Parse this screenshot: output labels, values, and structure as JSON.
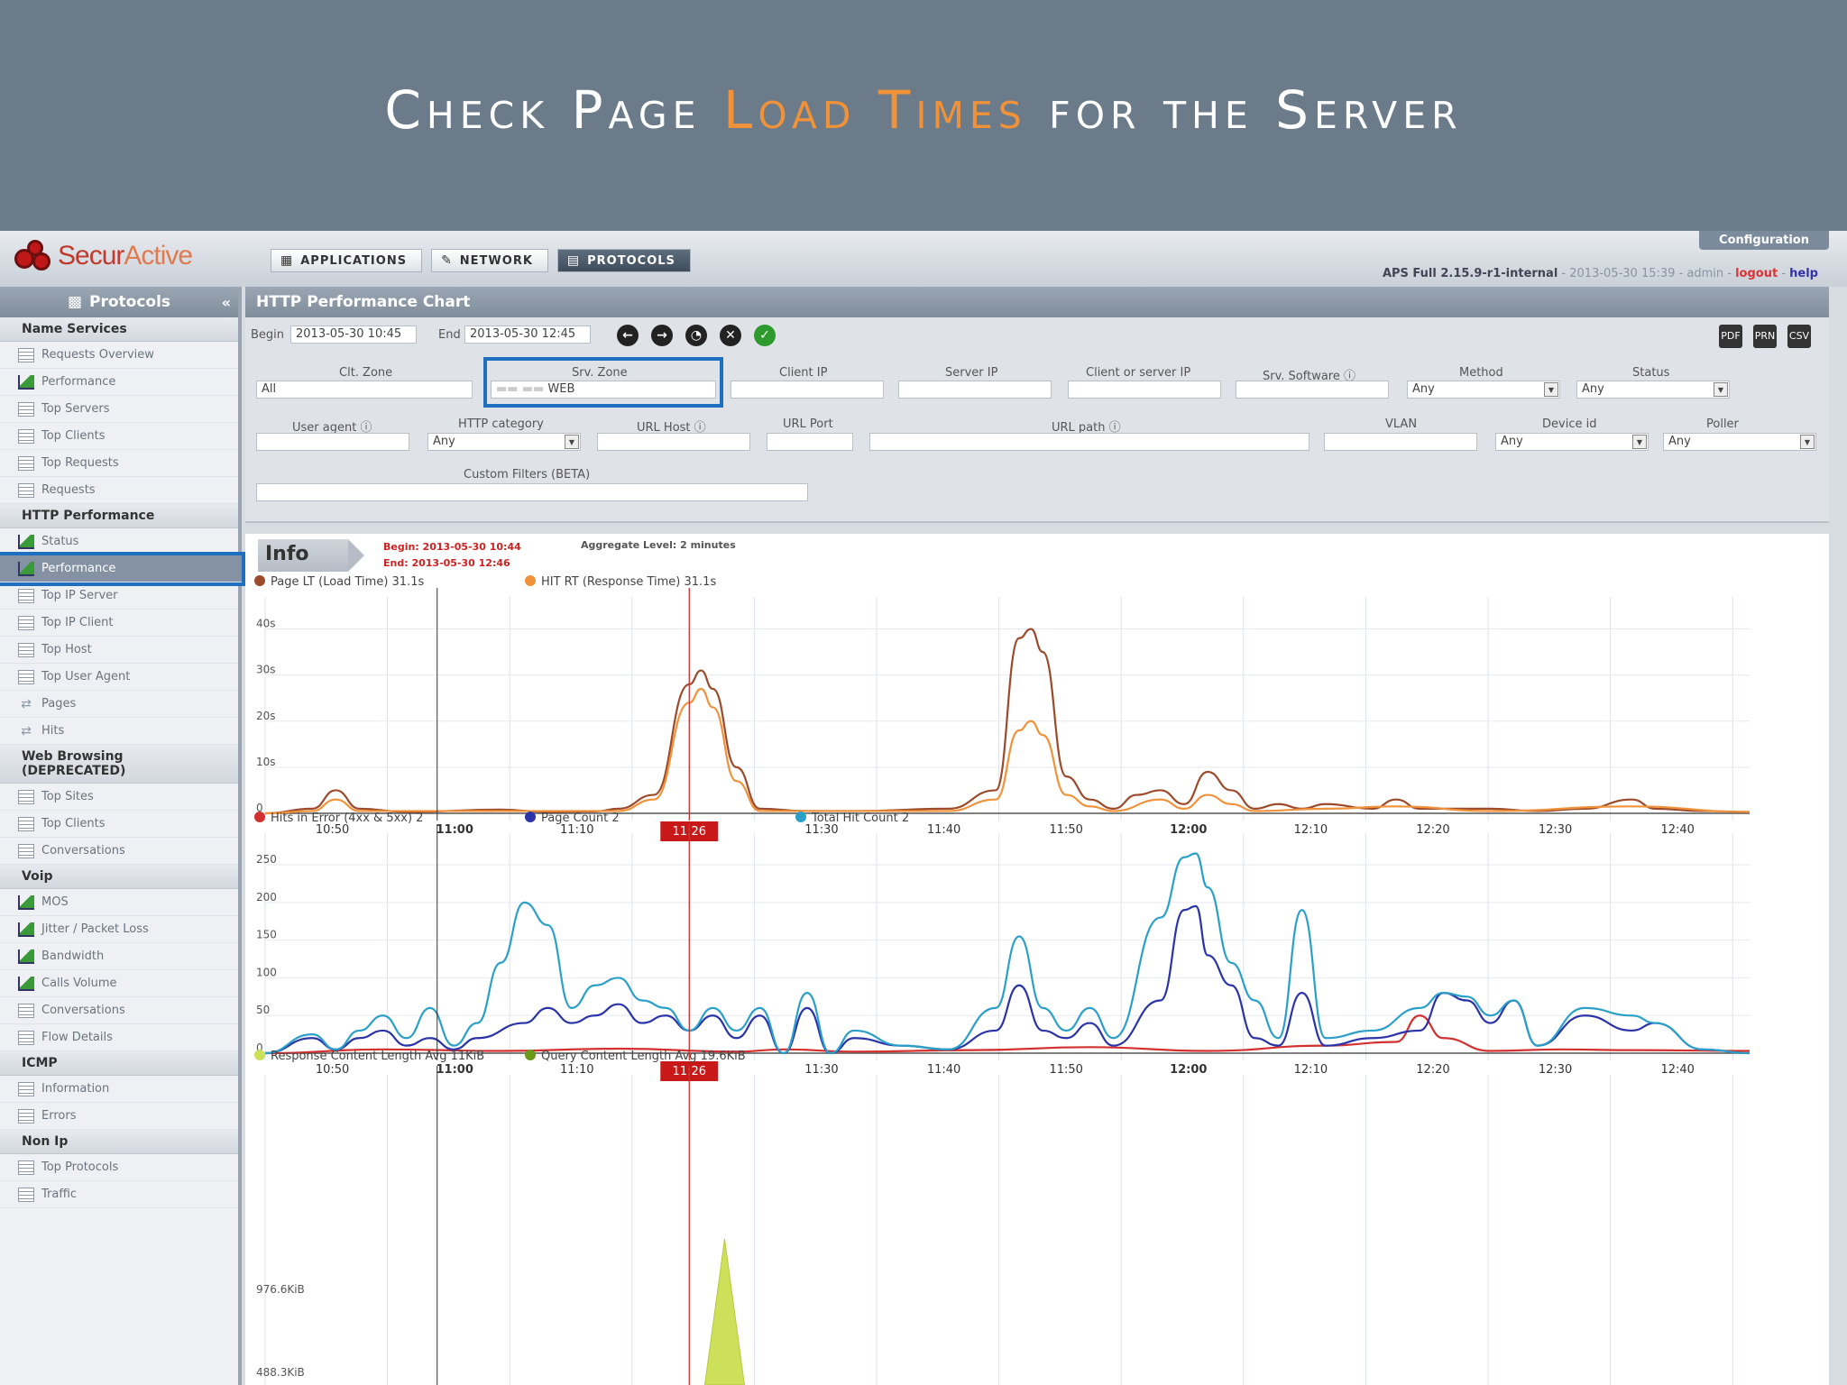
{
  "banner": {
    "title_a": "Check Page ",
    "title_hl": "Load Times",
    "title_b": " for the Server"
  },
  "header": {
    "logo_a": "Secur",
    "logo_b": "Active",
    "tabs": [
      {
        "label": "APPLICATIONS"
      },
      {
        "label": "NETWORK"
      },
      {
        "label": "PROTOCOLS"
      }
    ],
    "config_label": "Configuration",
    "version": "APS Full 2.15.9-r1-internal",
    "datetime": "2013-05-30 15:39",
    "user": "admin",
    "logout": "logout",
    "help": "help",
    "sep": " - "
  },
  "sidebar": {
    "title": "Protocols",
    "sections": [
      {
        "title": "Name Services",
        "items": [
          {
            "label": "Requests Overview",
            "icon": "table-icon"
          },
          {
            "label": "Performance",
            "icon": "chart-icon"
          },
          {
            "label": "Top Servers",
            "icon": "table-icon"
          },
          {
            "label": "Top Clients",
            "icon": "table-icon"
          },
          {
            "label": "Top Requests",
            "icon": "table-icon"
          },
          {
            "label": "Requests",
            "icon": "grid-icon"
          }
        ]
      },
      {
        "title": "HTTP Performance",
        "items": [
          {
            "label": "Status",
            "icon": "chart-icon"
          },
          {
            "label": "Performance",
            "icon": "chart-icon",
            "selected": true
          },
          {
            "label": "Top IP Server",
            "icon": "table-icon"
          },
          {
            "label": "Top IP Client",
            "icon": "table-icon"
          },
          {
            "label": "Top Host",
            "icon": "table-icon"
          },
          {
            "label": "Top User Agent",
            "icon": "table-icon"
          },
          {
            "label": "Pages",
            "icon": "arrows-icon"
          },
          {
            "label": "Hits",
            "icon": "arrows-icon"
          }
        ]
      },
      {
        "title": "Web Browsing (DEPRECATED)",
        "items": [
          {
            "label": "Top Sites",
            "icon": "table-icon"
          },
          {
            "label": "Top Clients",
            "icon": "table-icon"
          },
          {
            "label": "Conversations",
            "icon": "grid-icon"
          }
        ]
      },
      {
        "title": "Voip",
        "items": [
          {
            "label": "MOS",
            "icon": "chart-icon"
          },
          {
            "label": "Jitter / Packet Loss",
            "icon": "chart-icon"
          },
          {
            "label": "Bandwidth",
            "icon": "chart-icon"
          },
          {
            "label": "Calls Volume",
            "icon": "chart-icon"
          },
          {
            "label": "Conversations",
            "icon": "grid-icon"
          },
          {
            "label": "Flow Details",
            "icon": "grid-icon"
          }
        ]
      },
      {
        "title": "ICMP",
        "items": [
          {
            "label": "Information",
            "icon": "grid-icon"
          },
          {
            "label": "Errors",
            "icon": "grid-icon"
          }
        ]
      },
      {
        "title": "Non Ip",
        "items": [
          {
            "label": "Top Protocols",
            "icon": "table-icon"
          },
          {
            "label": "Traffic",
            "icon": "grid-icon"
          }
        ]
      }
    ]
  },
  "main": {
    "title": "HTTP Performance Chart",
    "begin_label": "Begin",
    "begin_value": "2013-05-30 10:45",
    "end_label": "End",
    "end_value": "2013-05-30 12:45",
    "filters": {
      "clt_zone_label": "Clt. Zone",
      "clt_zone_value": "All",
      "srv_zone_label": "Srv. Zone",
      "srv_zone_value": "WEB",
      "client_ip_label": "Client IP",
      "server_ip_label": "Server IP",
      "client_or_server_ip_label": "Client or server IP",
      "srv_software_label": "Srv. Software",
      "method_label": "Method",
      "method_value": "Any",
      "status_label": "Status",
      "status_value": "Any",
      "user_agent_label": "User agent",
      "http_category_label": "HTTP category",
      "http_category_value": "Any",
      "url_host_label": "URL Host",
      "url_port_label": "URL Port",
      "url_path_label": "URL path",
      "vlan_label": "VLAN",
      "device_id_label": "Device id",
      "device_id_value": "Any",
      "poller_label": "Poller",
      "poller_value": "Any",
      "custom_label": "Custom Filters (BETA)"
    },
    "export": [
      "PDF",
      "PRN",
      "CSV"
    ]
  },
  "chart_info": {
    "info_label": "Info",
    "begin": "Begin: 2013-05-30 10:44",
    "end": "End: 2013-05-30 12:46",
    "aggregate": "Aggregate Level: 2 minutes",
    "cursor_label": "11:26"
  },
  "chart_data": [
    {
      "type": "line",
      "x": [
        "10:50",
        "11:00",
        "11:10",
        "11:20",
        "11:30",
        "11:40",
        "11:50",
        "12:00",
        "12:10",
        "12:20",
        "12:30",
        "12:40"
      ],
      "ylim": [
        0,
        45
      ],
      "yticks": [
        "0",
        "10s",
        "20s",
        "30s",
        "40s"
      ],
      "series": [
        {
          "name": "Page LT (Load Time)",
          "summary": "31.1s",
          "color": "#9c4a2a",
          "points": [
            [
              0,
              0
            ],
            [
              4,
              1
            ],
            [
              6,
              5
            ],
            [
              8,
              1
            ],
            [
              12,
              0.3
            ],
            [
              20,
              0.8
            ],
            [
              24,
              0.3
            ],
            [
              28,
              0.4
            ],
            [
              30,
              1
            ],
            [
              33,
              4
            ],
            [
              36,
              28
            ],
            [
              37,
              31
            ],
            [
              38,
              27
            ],
            [
              40,
              10
            ],
            [
              42,
              1
            ],
            [
              46,
              0.5
            ],
            [
              50,
              0.5
            ],
            [
              58,
              1
            ],
            [
              62,
              5
            ],
            [
              64,
              38
            ],
            [
              65,
              40
            ],
            [
              66,
              35
            ],
            [
              68,
              8
            ],
            [
              70,
              3
            ],
            [
              72,
              1
            ],
            [
              74,
              4
            ],
            [
              76,
              5
            ],
            [
              78,
              2
            ],
            [
              80,
              9
            ],
            [
              82,
              5
            ],
            [
              84,
              1
            ],
            [
              86,
              2
            ],
            [
              88,
              1
            ],
            [
              90,
              2
            ],
            [
              94,
              1
            ],
            [
              96,
              3
            ],
            [
              98,
              1
            ],
            [
              104,
              1
            ],
            [
              108,
              0.5
            ],
            [
              112,
              1
            ],
            [
              116,
              3
            ],
            [
              118,
              1
            ],
            [
              122,
              0.5
            ],
            [
              126,
              0.3
            ]
          ]
        },
        {
          "name": "HIT RT (Response Time)",
          "summary": "31.1s",
          "color": "#f0923a",
          "points": [
            [
              0,
              0
            ],
            [
              4,
              0.5
            ],
            [
              6,
              3
            ],
            [
              8,
              0.5
            ],
            [
              20,
              0.5
            ],
            [
              30,
              0.5
            ],
            [
              33,
              3
            ],
            [
              36,
              24
            ],
            [
              37,
              27
            ],
            [
              38,
              23
            ],
            [
              40,
              7
            ],
            [
              42,
              0.5
            ],
            [
              58,
              0.5
            ],
            [
              62,
              3
            ],
            [
              64,
              18
            ],
            [
              65,
              20
            ],
            [
              66,
              17
            ],
            [
              68,
              4
            ],
            [
              70,
              1.5
            ],
            [
              72,
              0.5
            ],
            [
              76,
              3
            ],
            [
              78,
              1
            ],
            [
              80,
              4
            ],
            [
              82,
              2
            ],
            [
              84,
              0.5
            ],
            [
              90,
              1
            ],
            [
              96,
              1.5
            ],
            [
              104,
              0.5
            ],
            [
              116,
              1.5
            ],
            [
              126,
              0.3
            ]
          ]
        }
      ]
    },
    {
      "type": "line",
      "x": [
        "10:50",
        "11:00",
        "11:10",
        "11:20",
        "11:30",
        "11:40",
        "11:50",
        "12:00",
        "12:10",
        "12:20",
        "12:30",
        "12:40"
      ],
      "ylim": [
        0,
        280
      ],
      "yticks": [
        "0",
        "50",
        "100",
        "150",
        "200",
        "250"
      ],
      "series": [
        {
          "name": "Hits in Error (4xx & 5xx)",
          "summary": "2",
          "color": "#d33030",
          "points": [
            [
              0,
              0
            ],
            [
              10,
              5
            ],
            [
              20,
              3
            ],
            [
              30,
              6
            ],
            [
              40,
              2
            ],
            [
              44,
              5
            ],
            [
              50,
              2
            ],
            [
              60,
              4
            ],
            [
              70,
              8
            ],
            [
              80,
              3
            ],
            [
              90,
              10
            ],
            [
              96,
              15
            ],
            [
              98,
              50
            ],
            [
              100,
              20
            ],
            [
              104,
              3
            ],
            [
              110,
              5
            ],
            [
              116,
              4
            ],
            [
              126,
              3
            ]
          ]
        },
        {
          "name": "Page Count",
          "summary": "2",
          "color": "#2a34a8",
          "points": [
            [
              0,
              0
            ],
            [
              4,
              20
            ],
            [
              6,
              5
            ],
            [
              8,
              20
            ],
            [
              10,
              30
            ],
            [
              12,
              10
            ],
            [
              14,
              20
            ],
            [
              16,
              5
            ],
            [
              18,
              20
            ],
            [
              22,
              40
            ],
            [
              24,
              60
            ],
            [
              26,
              40
            ],
            [
              28,
              50
            ],
            [
              30,
              65
            ],
            [
              32,
              40
            ],
            [
              34,
              50
            ],
            [
              36,
              30
            ],
            [
              38,
              50
            ],
            [
              40,
              20
            ],
            [
              42,
              50
            ],
            [
              44,
              0
            ],
            [
              46,
              60
            ],
            [
              48,
              0
            ],
            [
              50,
              20
            ],
            [
              54,
              10
            ],
            [
              58,
              5
            ],
            [
              62,
              30
            ],
            [
              64,
              90
            ],
            [
              66,
              30
            ],
            [
              68,
              20
            ],
            [
              70,
              40
            ],
            [
              72,
              10
            ],
            [
              76,
              70
            ],
            [
              78,
              190
            ],
            [
              79,
              195
            ],
            [
              80,
              130
            ],
            [
              82,
              90
            ],
            [
              84,
              20
            ],
            [
              86,
              10
            ],
            [
              88,
              80
            ],
            [
              90,
              10
            ],
            [
              94,
              20
            ],
            [
              98,
              30
            ],
            [
              100,
              80
            ],
            [
              102,
              70
            ],
            [
              104,
              40
            ],
            [
              106,
              70
            ],
            [
              108,
              10
            ],
            [
              112,
              50
            ],
            [
              116,
              30
            ],
            [
              118,
              40
            ],
            [
              122,
              5
            ],
            [
              126,
              0
            ]
          ]
        },
        {
          "name": "Total Hit Count",
          "summary": "2",
          "color": "#2aa0c8",
          "points": [
            [
              0,
              0
            ],
            [
              4,
              25
            ],
            [
              6,
              5
            ],
            [
              8,
              30
            ],
            [
              10,
              50
            ],
            [
              12,
              20
            ],
            [
              14,
              60
            ],
            [
              16,
              10
            ],
            [
              18,
              40
            ],
            [
              20,
              120
            ],
            [
              22,
              200
            ],
            [
              24,
              170
            ],
            [
              26,
              60
            ],
            [
              28,
              90
            ],
            [
              30,
              100
            ],
            [
              32,
              70
            ],
            [
              34,
              60
            ],
            [
              36,
              30
            ],
            [
              38,
              60
            ],
            [
              40,
              30
            ],
            [
              42,
              60
            ],
            [
              44,
              0
            ],
            [
              46,
              80
            ],
            [
              48,
              0
            ],
            [
              50,
              30
            ],
            [
              54,
              10
            ],
            [
              58,
              5
            ],
            [
              62,
              60
            ],
            [
              64,
              155
            ],
            [
              66,
              60
            ],
            [
              68,
              30
            ],
            [
              70,
              60
            ],
            [
              72,
              20
            ],
            [
              76,
              180
            ],
            [
              78,
              260
            ],
            [
              79,
              265
            ],
            [
              80,
              220
            ],
            [
              82,
              120
            ],
            [
              84,
              70
            ],
            [
              86,
              20
            ],
            [
              88,
              190
            ],
            [
              90,
              20
            ],
            [
              94,
              30
            ],
            [
              98,
              60
            ],
            [
              100,
              80
            ],
            [
              102,
              75
            ],
            [
              104,
              50
            ],
            [
              106,
              70
            ],
            [
              108,
              10
            ],
            [
              112,
              60
            ],
            [
              116,
              50
            ],
            [
              118,
              40
            ],
            [
              122,
              5
            ],
            [
              126,
              0
            ]
          ]
        }
      ]
    },
    {
      "type": "area",
      "ylim": [
        0,
        1200
      ],
      "yticks": [
        "976.6KiB",
        "488.3KiB"
      ],
      "series": [
        {
          "name": "Response Content Length Avg",
          "summary": "11KiB",
          "color": "#cde05a"
        },
        {
          "name": "Query Content Length Avg",
          "summary": "19.6KiB",
          "color": "#6a9a1a"
        }
      ]
    }
  ]
}
